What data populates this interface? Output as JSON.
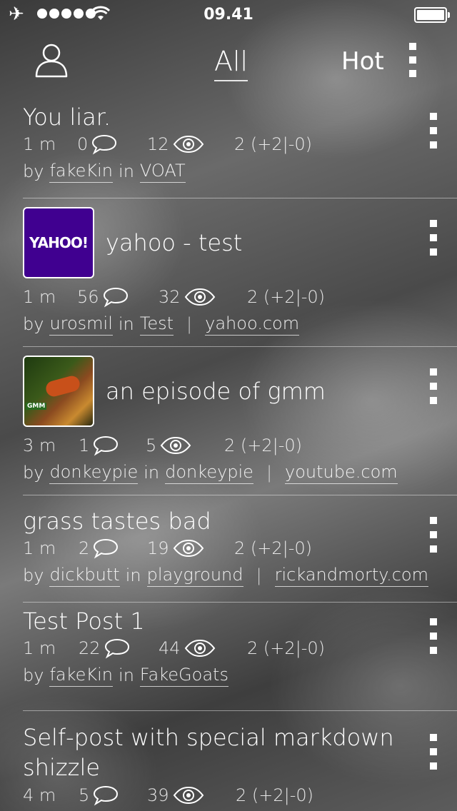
{
  "status_bar": {
    "time": "09.41",
    "signal_bars": 5,
    "battery_level": 1.0
  },
  "nav": {
    "tab_all": "All",
    "tab_hot": "Hot"
  },
  "posts": [
    {
      "title": "You liar.",
      "age": "1 m",
      "comments": "0",
      "views": "12",
      "score": "2 (+2|-0)",
      "by_label": "by",
      "author": "fakeKin",
      "in_label": "in",
      "sub": "VOAT"
    },
    {
      "title": "yahoo - test",
      "thumb": "yahoo",
      "thumb_text": "YAHOO!",
      "age": "1 m",
      "comments": "56",
      "views": "32",
      "score": "2 (+2|-0)",
      "by_label": "by",
      "author": "urosmil",
      "in_label": "in",
      "sub": "Test",
      "domain": "yahoo.com"
    },
    {
      "title": "an episode of gmm",
      "thumb": "gmm",
      "thumb_text": "GMM",
      "age": "3 m",
      "comments": "1",
      "views": "5",
      "score": "2 (+2|-0)",
      "by_label": "by",
      "author": "donkeypie",
      "in_label": "in",
      "sub": "donkeypie",
      "domain": "youtube.com"
    },
    {
      "title": "grass tastes bad",
      "age": "1 m",
      "comments": "2",
      "views": "19",
      "score": "2 (+2|-0)",
      "by_label": "by",
      "author": "dickbutt",
      "in_label": "in",
      "sub": "playground",
      "domain": "rickandmorty.com"
    },
    {
      "title": "Test Post 1",
      "age": "1 m",
      "comments": "22",
      "views": "44",
      "score": "2 (+2|-0)",
      "by_label": "by",
      "author": "fakeKin",
      "in_label": "in",
      "sub": "FakeGoats"
    },
    {
      "title": "Self-post with special markdown shizzle",
      "age": "4 m",
      "comments": "5",
      "views": "39",
      "score": "2 (+2|-0)"
    }
  ]
}
